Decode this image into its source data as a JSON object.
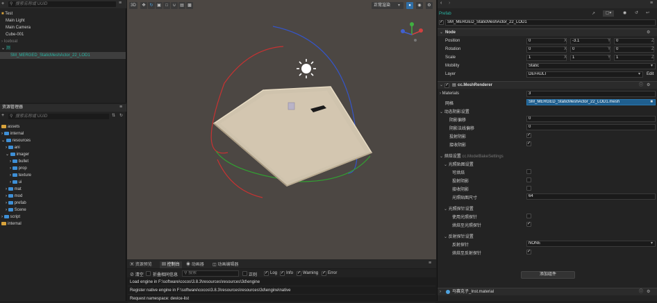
{
  "hierarchy": {
    "search_placeholder": "搜索名称或 UUID",
    "items": [
      {
        "label": "Test"
      },
      {
        "label": "Main Light"
      },
      {
        "label": "Main Camera"
      },
      {
        "label": "Cube-001"
      },
      {
        "label": "Iceboat"
      },
      {
        "label": "测"
      },
      {
        "label": "SM_MERGED_StaticMeshActor_22_LOD1"
      }
    ]
  },
  "assets": {
    "title": "资源管理器",
    "search_placeholder": "搜索名称或 UUID",
    "items": [
      {
        "label": "assets"
      },
      {
        "label": "internal"
      },
      {
        "label": "resources"
      },
      {
        "label": "ani"
      },
      {
        "label": "imager"
      },
      {
        "label": "bullet"
      },
      {
        "label": "prop"
      },
      {
        "label": "texture"
      },
      {
        "label": "ui"
      },
      {
        "label": "mat"
      },
      {
        "label": "mod"
      },
      {
        "label": "prefab"
      },
      {
        "label": "Scene"
      },
      {
        "label": "script"
      },
      {
        "label": "internal"
      }
    ]
  },
  "scene_toolbar": {
    "mode_3d": "3D",
    "view_mode": "正常渲染"
  },
  "console": {
    "tabs": [
      {
        "label": "资源预览"
      },
      {
        "label": "控制台"
      },
      {
        "label": "动画器"
      },
      {
        "label": "动画编辑器"
      }
    ],
    "clear_label": "清空",
    "collapse_label": "折叠相同信息",
    "search_placeholder": "搜索",
    "regex_label": "正则",
    "filters": [
      {
        "label": "Log"
      },
      {
        "label": "Info"
      },
      {
        "label": "Warning"
      },
      {
        "label": "Error"
      }
    ],
    "logs": [
      "Load engine in F:\\software\\cocos\\3.8.3\\resources\\resources\\3d\\engine",
      "Register native engine in F:\\software\\cocos\\3.8.3\\resources\\resources\\3d\\engine\\native",
      "Request namespace: device-list"
    ]
  },
  "inspector": {
    "prefab_label": "Prefab",
    "node_name": "SM_MERGED_StaticMeshActor_22_LOD1",
    "node_section": "Node",
    "position": {
      "label": "Position",
      "x": "0",
      "y": "-3.1",
      "z": "0"
    },
    "rotation": {
      "label": "Rotation",
      "x": "0",
      "y": "0",
      "z": "0"
    },
    "scale": {
      "label": "Scale",
      "x": "1",
      "y": "1",
      "z": "1"
    },
    "axis_x": "X",
    "axis_y": "Y",
    "axis_z": "Z",
    "mobility": {
      "label": "Mobility",
      "value": "Static"
    },
    "layer": {
      "label": "Layer",
      "value": "DEFAULT",
      "edit": "Edit"
    },
    "mesh_renderer": {
      "title": "cc.MeshRenderer",
      "materials_label": "Materials",
      "materials_value": "3",
      "mesh_label": "网格",
      "mesh_value": "SM_MERGED_StaticMeshActor_22_LOD1.mesh",
      "shadow_group": "动态阴影设置",
      "shadow_bias": {
        "label": "阴影偏移",
        "value": "0"
      },
      "shadow_normal_bias": {
        "label": "阴影法线偏移",
        "value": "0"
      },
      "cast_shadow": "投射阴影",
      "receive_shadow": "接收阴影",
      "bake_group": "烘焙设置",
      "bake_type": "cc.ModelBakeSettings",
      "lightmap_group": "光照贴图设置",
      "bakeable": "可烘焙",
      "bake_cast_shadow": "投射阴影",
      "bake_receive_shadow": "接收阴影",
      "lightmap_size": {
        "label": "光照贴图尺寸",
        "value": "64"
      },
      "probe_group": "光照探针设置",
      "use_probe": "使用光照探针",
      "bake_to_probe": "烘焙至光照探针",
      "reflection_group": "反射探针设置",
      "reflection_probe": {
        "label": "反射探针",
        "value": "NONE"
      },
      "bake_to_reflection": "烘焙至反射探针",
      "add_component": "添加组件"
    },
    "material_section": "马赛克子_Inst.material"
  },
  "colors": {
    "accent": "#29b6a4",
    "selection": "#3e3e3e",
    "mesh_field": "#1f5f8f",
    "floor": "#4a4440"
  }
}
